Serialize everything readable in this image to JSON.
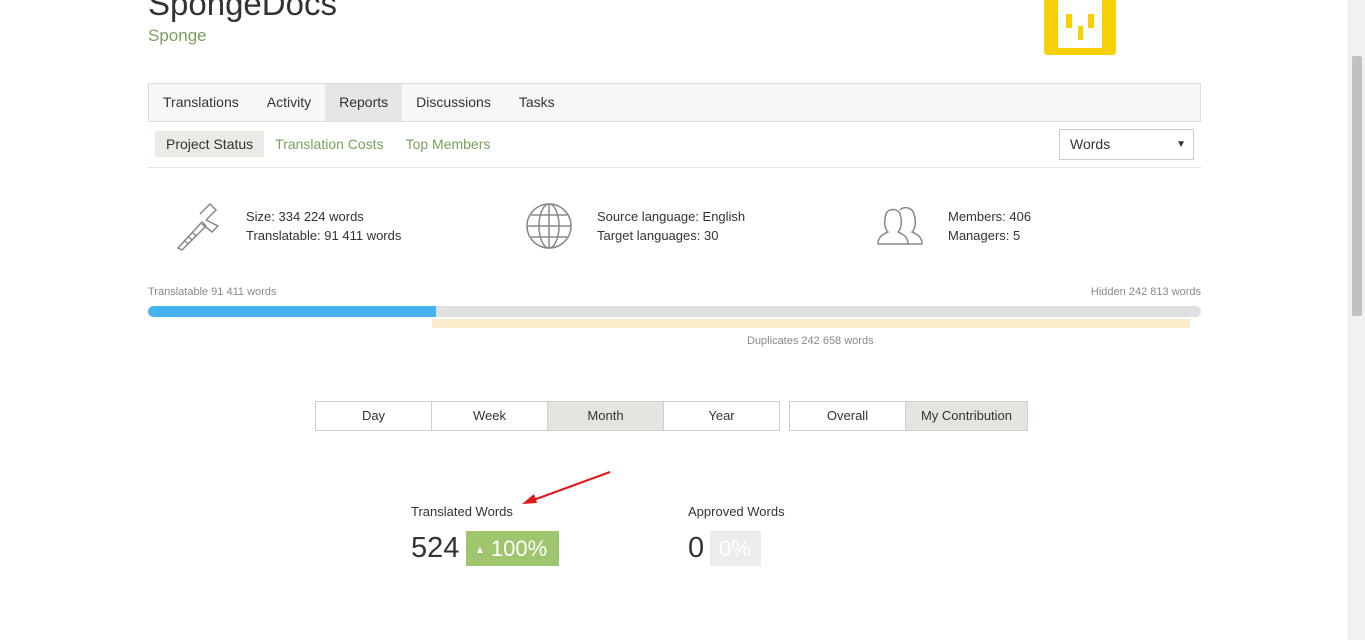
{
  "project": {
    "title": "SpongeDocs",
    "subtitle": "Sponge"
  },
  "colors": {
    "accent_green": "#7aa05e",
    "progress_blue": "#47b2f0",
    "badge_green": "#9fc66f",
    "duplicates": "#fbeccb",
    "logo_yellow": "#f6d000"
  },
  "tabs": [
    {
      "label": "Translations",
      "active": false
    },
    {
      "label": "Activity",
      "active": false
    },
    {
      "label": "Reports",
      "active": true
    },
    {
      "label": "Discussions",
      "active": false
    },
    {
      "label": "Tasks",
      "active": false
    }
  ],
  "subnav": [
    {
      "label": "Project Status",
      "active": true
    },
    {
      "label": "Translation Costs",
      "active": false
    },
    {
      "label": "Top Members",
      "active": false
    }
  ],
  "unit_select": {
    "value": "Words",
    "icon": "caret-down-icon"
  },
  "stats": {
    "size": {
      "icon": "caliper-icon",
      "line1": "Size: 334 224 words",
      "line2": "Translatable: 91 411 words"
    },
    "languages": {
      "icon": "globe-icon",
      "line1": "Source language: English",
      "line2": "Target languages: 30"
    },
    "members": {
      "icon": "members-icon",
      "line1": "Members: 406",
      "line2": "Managers: 5"
    }
  },
  "progress": {
    "translatable_label": "Translatable 91 411 words",
    "hidden_label": "Hidden 242 813 words",
    "duplicates_label": "Duplicates 242 658 words",
    "translatable_fraction": 0.2737
  },
  "period_buttons": [
    {
      "label": "Day",
      "active": false
    },
    {
      "label": "Week",
      "active": false
    },
    {
      "label": "Month",
      "active": true
    },
    {
      "label": "Year",
      "active": false
    }
  ],
  "scope_buttons": [
    {
      "label": "Overall",
      "active": false
    },
    {
      "label": "My Contribution",
      "active": true
    }
  ],
  "metrics": {
    "translated": {
      "title": "Translated Words",
      "value": "524",
      "change": "100%",
      "icon": "triangle-up-icon"
    },
    "approved": {
      "title": "Approved Words",
      "value": "0",
      "change": "0%"
    }
  }
}
